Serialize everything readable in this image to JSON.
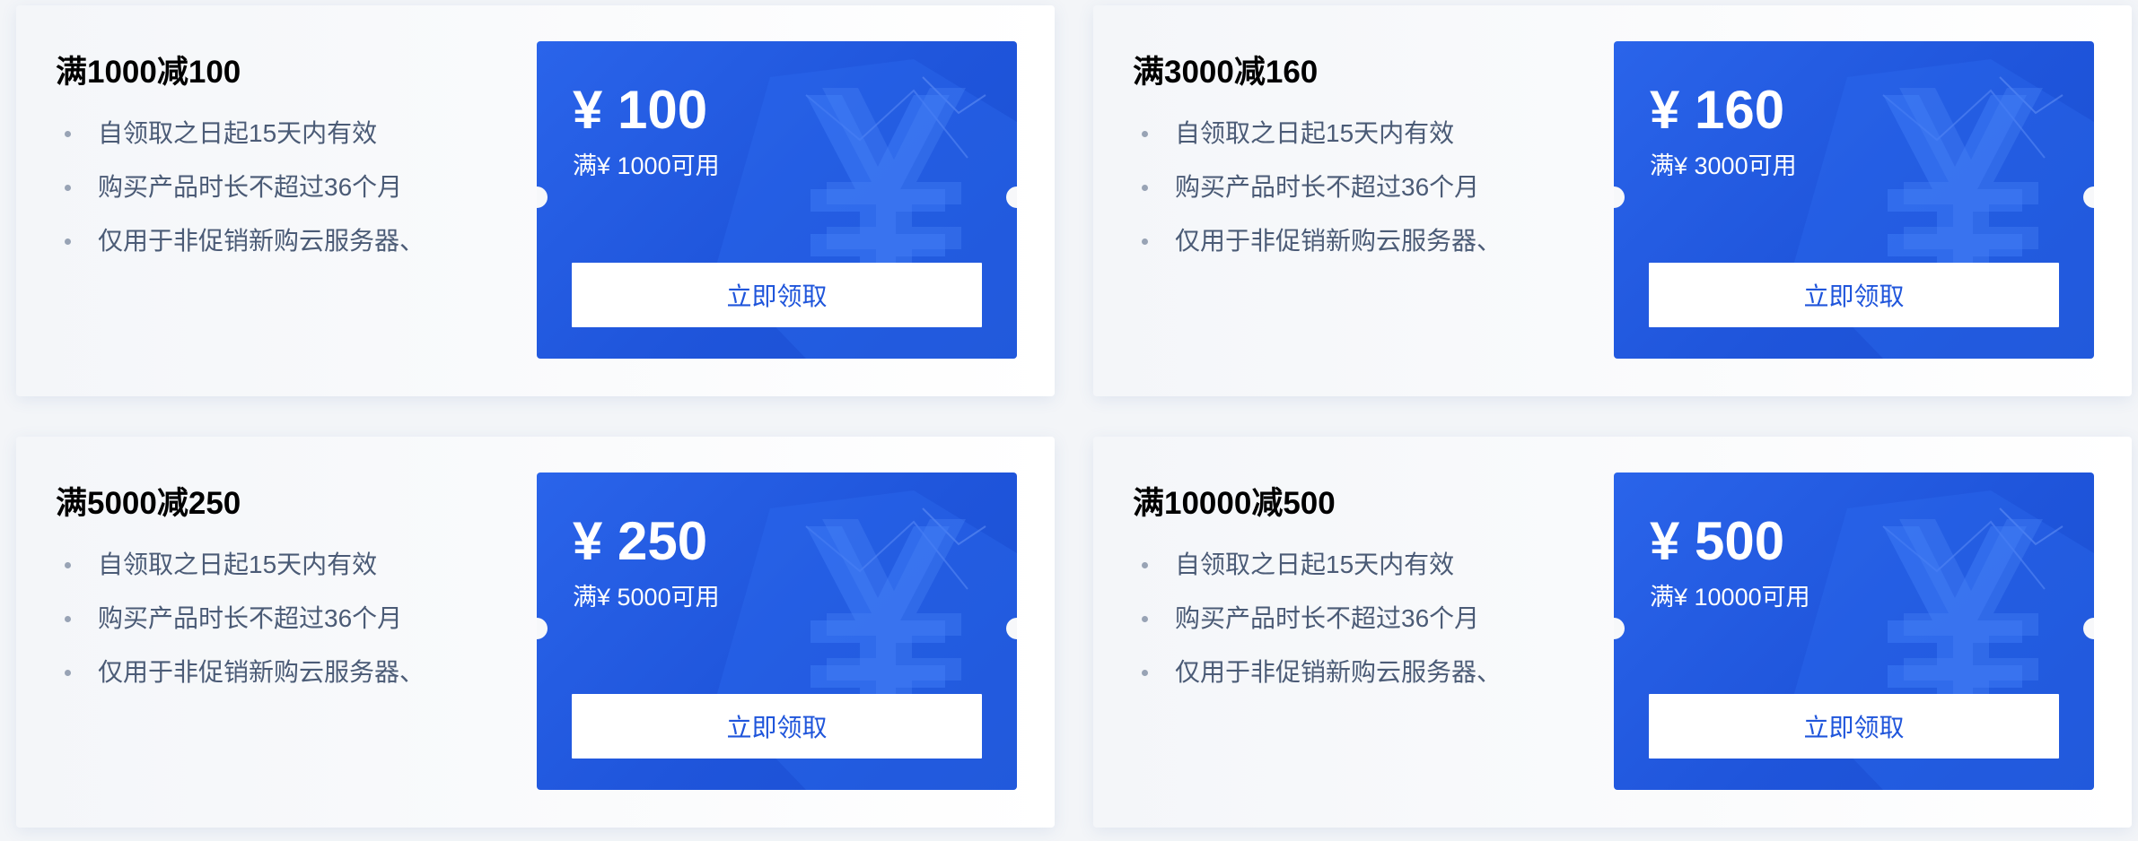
{
  "colors": {
    "coupon_blue": "#2a64ea",
    "button_text": "#1f55db",
    "title_text": "#000000",
    "rule_text": "#4b5b76"
  },
  "icons": {
    "bullet": "bullet-dot-icon",
    "background_graphic": "yuan-3d-watermark-icon"
  },
  "cards": [
    {
      "title": "满1000减100",
      "rules": [
        "自领取之日起15天内有效",
        "购买产品时长不超过36个月",
        "仅用于非促销新购云服务器、"
      ],
      "amount": "¥ 100",
      "condition": "满¥ 1000可用",
      "button": "立即领取"
    },
    {
      "title": "满3000减160",
      "rules": [
        "自领取之日起15天内有效",
        "购买产品时长不超过36个月",
        "仅用于非促销新购云服务器、"
      ],
      "amount": "¥ 160",
      "condition": "满¥ 3000可用",
      "button": "立即领取"
    },
    {
      "title": "满5000减250",
      "rules": [
        "自领取之日起15天内有效",
        "购买产品时长不超过36个月",
        "仅用于非促销新购云服务器、"
      ],
      "amount": "¥ 250",
      "condition": "满¥ 5000可用",
      "button": "立即领取"
    },
    {
      "title": "满10000减500",
      "rules": [
        "自领取之日起15天内有效",
        "购买产品时长不超过36个月",
        "仅用于非促销新购云服务器、"
      ],
      "amount": "¥ 500",
      "condition": "满¥ 10000可用",
      "button": "立即领取"
    }
  ]
}
